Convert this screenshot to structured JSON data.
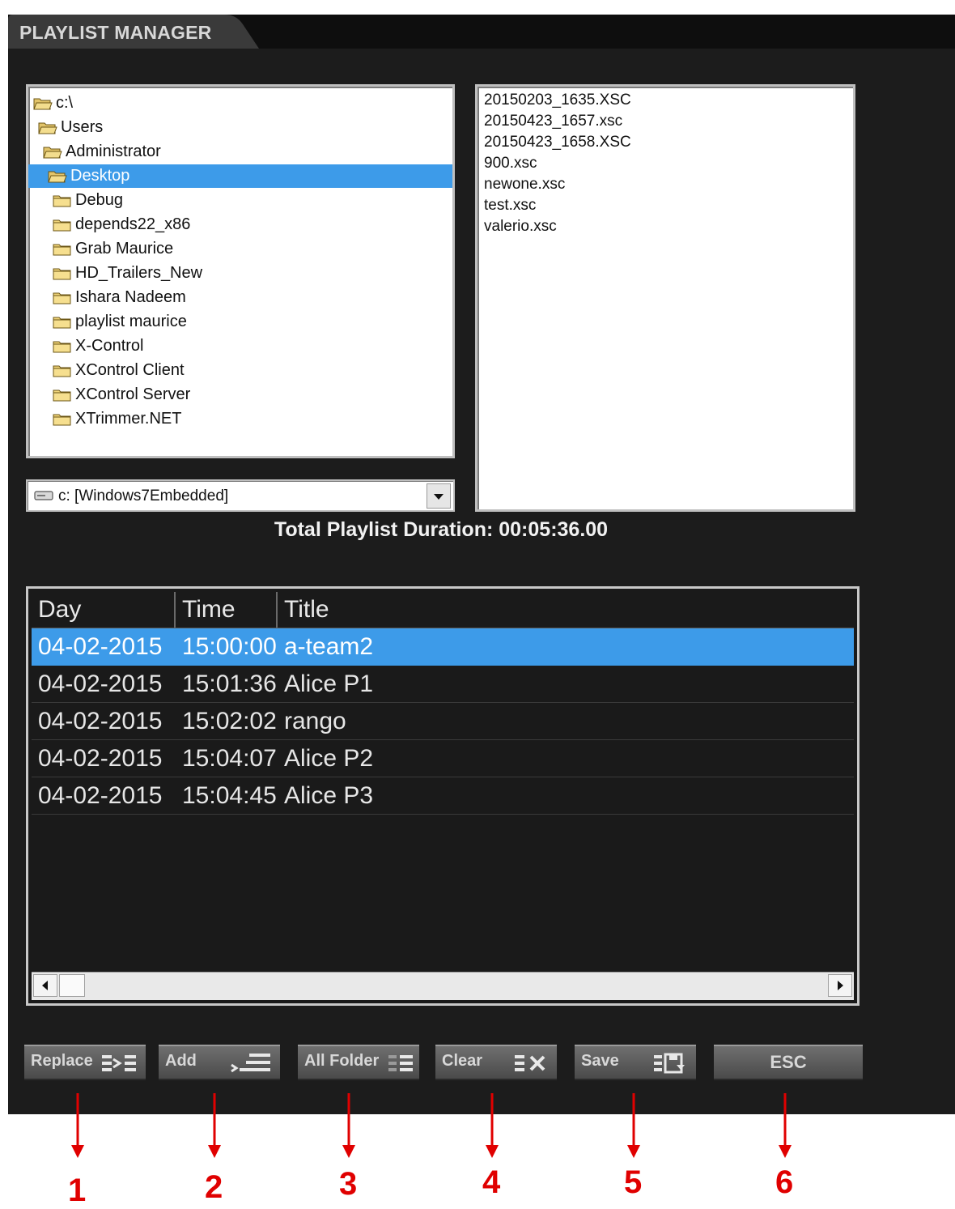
{
  "window": {
    "title": "PLAYLIST MANAGER"
  },
  "tree": {
    "items": [
      {
        "label": "c:\\",
        "indent": 0,
        "open": true
      },
      {
        "label": "Users",
        "indent": 1,
        "open": true
      },
      {
        "label": "Administrator",
        "indent": 2,
        "open": true
      },
      {
        "label": "Desktop",
        "indent": 3,
        "open": true,
        "selected": true
      },
      {
        "label": "Debug",
        "indent": 4
      },
      {
        "label": "depends22_x86",
        "indent": 4
      },
      {
        "label": "Grab Maurice",
        "indent": 4
      },
      {
        "label": "HD_Trailers_New",
        "indent": 4
      },
      {
        "label": "Ishara Nadeem",
        "indent": 4
      },
      {
        "label": "playlist maurice",
        "indent": 4
      },
      {
        "label": "X-Control",
        "indent": 4
      },
      {
        "label": "XControl Client",
        "indent": 4
      },
      {
        "label": "XControl Server",
        "indent": 4
      },
      {
        "label": "XTrimmer.NET",
        "indent": 4
      }
    ]
  },
  "files": [
    "20150203_1635.XSC",
    "20150423_1657.xsc",
    "20150423_1658.XSC",
    "900.xsc",
    "newone.xsc",
    "test.xsc",
    "valerio.xsc"
  ],
  "drive": {
    "label": "c: [Windows7Embedded]"
  },
  "duration": "Total Playlist Duration: 00:05:36.00",
  "playlist": {
    "columns": [
      "Day",
      "Time",
      "Title"
    ],
    "rows": [
      {
        "day": "04-02-2015",
        "time": "15:00:00",
        "title": "a-team2",
        "selected": true
      },
      {
        "day": "04-02-2015",
        "time": "15:01:36",
        "title": "Alice P1"
      },
      {
        "day": "04-02-2015",
        "time": "15:02:02",
        "title": "rango"
      },
      {
        "day": "04-02-2015",
        "time": "15:04:07",
        "title": "Alice P2"
      },
      {
        "day": "04-02-2015",
        "time": "15:04:45",
        "title": "Alice P3"
      }
    ]
  },
  "buttons": {
    "replace": "Replace",
    "add": "Add",
    "all_folder": "All Folder",
    "clear": "Clear",
    "save": "Save",
    "esc": "ESC"
  },
  "annotations": [
    "1",
    "2",
    "3",
    "4",
    "5",
    "6"
  ],
  "colors": {
    "selection": "#3d9be9",
    "annotation": "#e00000",
    "window_bg": "#1c1c1c"
  }
}
